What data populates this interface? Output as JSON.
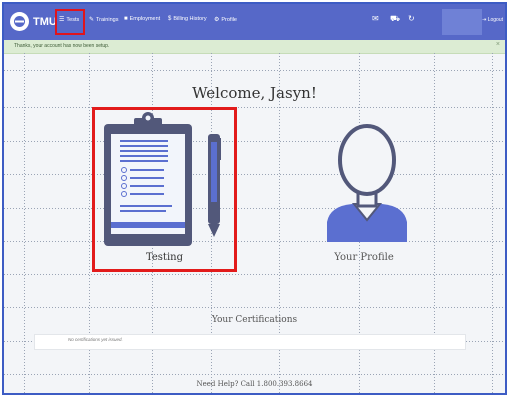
{
  "navbar": {
    "brand": "TMU",
    "items": [
      {
        "icon": "list-icon",
        "label": "Tests"
      },
      {
        "icon": "wrench-icon",
        "label": "Trainings"
      },
      {
        "icon": "briefcase-icon",
        "label": "Employment"
      },
      {
        "icon": "dollar-icon",
        "label": "Billing History"
      },
      {
        "icon": "gear-icon",
        "label": "Profile"
      }
    ],
    "right_icons": [
      "mail-icon",
      "cart-icon",
      "refresh-icon"
    ],
    "logout_label": "Logout",
    "colors": {
      "bar": "#5668c8",
      "highlight": "#e0141c"
    }
  },
  "alert": {
    "text": "Thanks, your account has now been setup.",
    "close": "×"
  },
  "main": {
    "welcome": "Welcome, Jasyn!",
    "cards": [
      {
        "label": "Testing",
        "icon": "clipboard-icon"
      },
      {
        "label": "Your Profile",
        "icon": "user-avatar-icon"
      }
    ],
    "certifications_title": "Your Certifications",
    "certifications_empty": "No certifications yet issued.",
    "help": "Need Help? Call 1.800.393.8664"
  }
}
